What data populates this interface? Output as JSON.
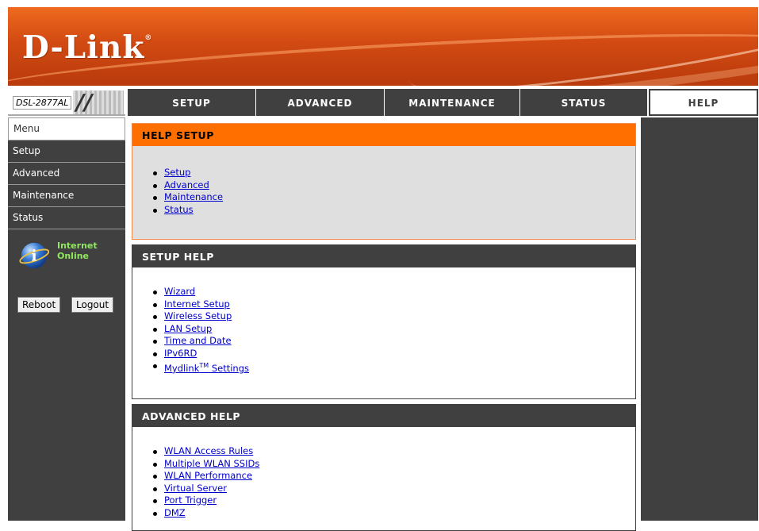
{
  "header": {
    "logo": "D-Link",
    "logo_reg": "®"
  },
  "model": "DSL-2877AL",
  "tabs": [
    {
      "label": "SETUP",
      "active": false
    },
    {
      "label": "ADVANCED",
      "active": false
    },
    {
      "label": "MAINTENANCE",
      "active": false
    },
    {
      "label": "STATUS",
      "active": false
    },
    {
      "label": "HELP",
      "active": true
    }
  ],
  "sidebar": {
    "items": [
      {
        "label": "Menu",
        "active": true
      },
      {
        "label": "Setup",
        "active": false
      },
      {
        "label": "Advanced",
        "active": false
      },
      {
        "label": "Maintenance",
        "active": false
      },
      {
        "label": "Status",
        "active": false
      }
    ],
    "internet_label": "Internet",
    "internet_status": "Online",
    "reboot": "Reboot",
    "logout": "Logout"
  },
  "sections": {
    "help_setup": {
      "title": "HELP SETUP",
      "links": [
        "Setup",
        "Advanced",
        "Maintenance",
        "Status"
      ]
    },
    "setup_help": {
      "title": "SETUP HELP",
      "links": [
        "Wizard",
        "Internet Setup",
        "Wireless Setup",
        "LAN Setup",
        "Time and Date",
        "IPv6RD"
      ],
      "mydlink_text": "Mydlink",
      "mydlink_tm": "TM",
      "mydlink_suffix": " Settings"
    },
    "advanced_help": {
      "title": "ADVANCED HELP",
      "links": [
        "WLAN Access Rules",
        "Multiple WLAN SSIDs",
        "WLAN Performance",
        "Virtual Server",
        "Port Trigger",
        "DMZ"
      ]
    }
  },
  "colors": {
    "accent": "#ff6f00",
    "dark": "#404040",
    "link": "#0000cc",
    "online": "#8fe85f"
  }
}
